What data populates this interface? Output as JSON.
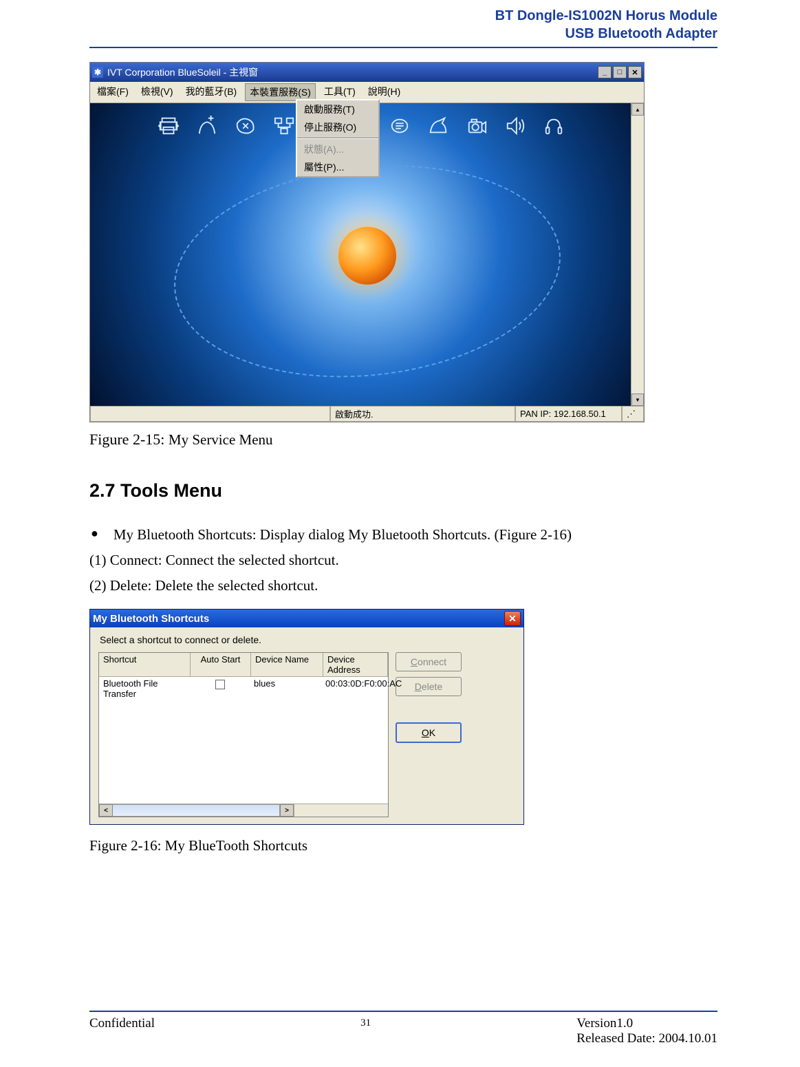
{
  "header": {
    "line1": "BT Dongle-IS1002N Horus Module",
    "line2": "USB Bluetooth Adapter"
  },
  "screenshot1": {
    "title": "IVT Corporation BlueSoleil - 主視窗",
    "menu": {
      "file": "檔案(F)",
      "view": "檢視(V)",
      "my_bt": "我的藍牙(B)",
      "device_service": "本裝置服務(S)",
      "tools": "工具(T)",
      "help": "說明(H)"
    },
    "dropdown": {
      "start": "啟動服務(T)",
      "stop": "停止服務(O)",
      "status": "狀態(A)...",
      "properties": "屬性(P)..."
    },
    "status_center": "啟動成功.",
    "status_right": "PAN IP: 192.168.50.1"
  },
  "caption1_prefix": "Figure 2-15: ",
  "caption1_text": "My Service Menu",
  "section_heading": "2.7   Tools Menu",
  "body": {
    "bullet": "My Bluetooth Shortcuts: Display dialog My Bluetooth Shortcuts. (Figure 2-16)",
    "line1": "(1) Connect: Connect the selected shortcut.",
    "line2": "(2) Delete: Delete the selected shortcut."
  },
  "screenshot2": {
    "title": "My Bluetooth Shortcuts",
    "instruction": "Select a shortcut to connect or delete.",
    "columns": {
      "c1": "Shortcut",
      "c2": "Auto Start",
      "c3": "Device Name",
      "c4": "Device Address"
    },
    "row": {
      "shortcut": "Bluetooth File Transfer",
      "auto_start_checked": false,
      "device_name": "blues",
      "device_address": "00:03:0D:F0:00:AC"
    },
    "buttons": {
      "connect": "Connect",
      "delete": "Delete",
      "ok": "OK"
    }
  },
  "caption2": "Figure 2-16: My BlueTooth Shortcuts",
  "footer": {
    "left": "Confidential",
    "page": "31",
    "right1": "Version1.0",
    "right2": "Released Date: 2004.10.01"
  }
}
